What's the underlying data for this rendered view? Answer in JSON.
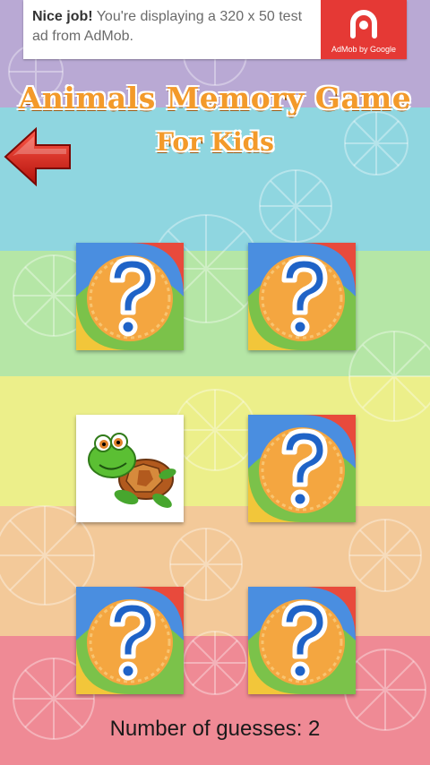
{
  "ad": {
    "headline": "Nice job!",
    "message": " You're displaying a 320 x 50 test ad from AdMob.",
    "logo_caption": "AdMob by Google",
    "color": "#e53935"
  },
  "header": {
    "title": "Animals Memory Game",
    "subtitle": "For Kids",
    "back_icon": "red-left-arrow-icon"
  },
  "board": {
    "columns": 2,
    "rows": 3,
    "cards": [
      {
        "state": "hidden",
        "icon": "question-mark-icon"
      },
      {
        "state": "hidden",
        "icon": "question-mark-icon"
      },
      {
        "state": "revealed",
        "icon": "turtle-icon"
      },
      {
        "state": "hidden",
        "icon": "question-mark-icon"
      },
      {
        "state": "hidden",
        "icon": "question-mark-icon"
      },
      {
        "state": "hidden",
        "icon": "question-mark-icon"
      }
    ]
  },
  "footer": {
    "guesses_label": "Number of guesses: ",
    "guesses": "2"
  },
  "colors": {
    "title": "#f39a2a",
    "stripes": [
      "#b9a9d4",
      "#8fd6e0",
      "#b5e6a6",
      "#ecef8a",
      "#f3c999",
      "#ef8a95"
    ]
  }
}
